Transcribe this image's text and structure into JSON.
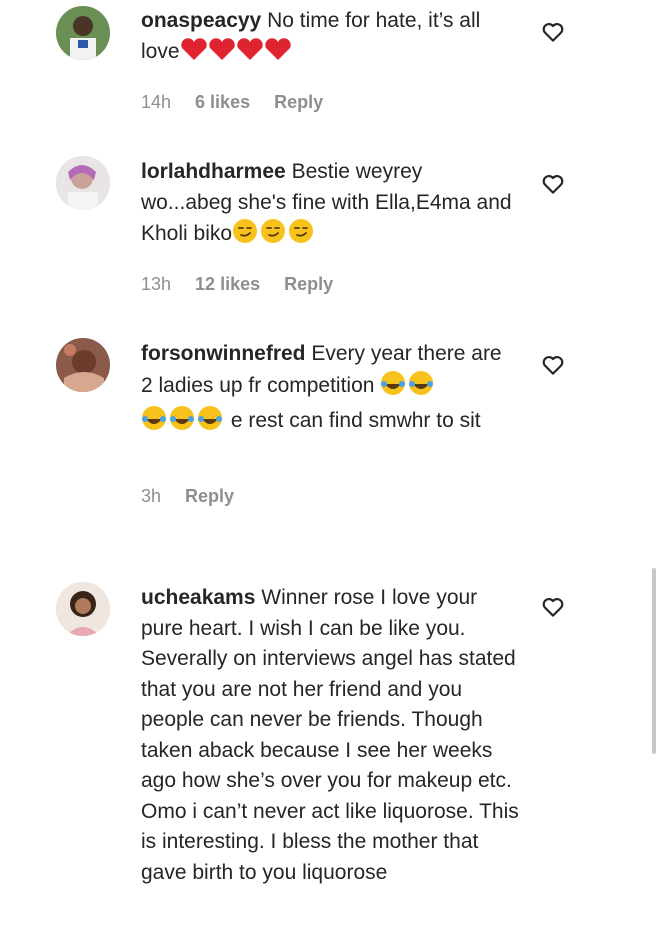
{
  "comments": [
    {
      "username": "onaspeacyy",
      "text": "No time for hate, it’s all love",
      "emoji": "❤️❤️❤️❤️",
      "time": "14h",
      "likes": "6 likes",
      "reply": "Reply"
    },
    {
      "username": "lorlahdharmee",
      "text": "Bestie weyrey wo...abeg she's fine with Ella,E4ma and Kholi biko",
      "emoji": "😏😏😏",
      "time": "13h",
      "likes": "12 likes",
      "reply": "Reply"
    },
    {
      "username": "forsonwinnefred",
      "text_a": "Every year there are 2 ladies up fr competition",
      "emoji_a": "😂😂",
      "emoji_b": "😂😂😂",
      "text_b": "e rest can find smwhr to sit",
      "time": "3h",
      "reply": "Reply"
    },
    {
      "username": "ucheakams",
      "text": "Winner rose I love your pure heart. I wish I can be like you. Severally on interviews angel has stated that you are not her friend and you people can never be friends. Though taken aback because I see her weeks ago how she’s over you for makeup etc. Omo i can’t never act like liquorose. This is interesting. I bless the mother that gave birth to you liquorose"
    }
  ],
  "colors": {
    "text": "#262626",
    "meta": "#8e8e8e",
    "heart_emoji": "#e0242f",
    "emoji_face": "#f7c21b"
  },
  "icons": {
    "like": "heart-outline-icon"
  }
}
